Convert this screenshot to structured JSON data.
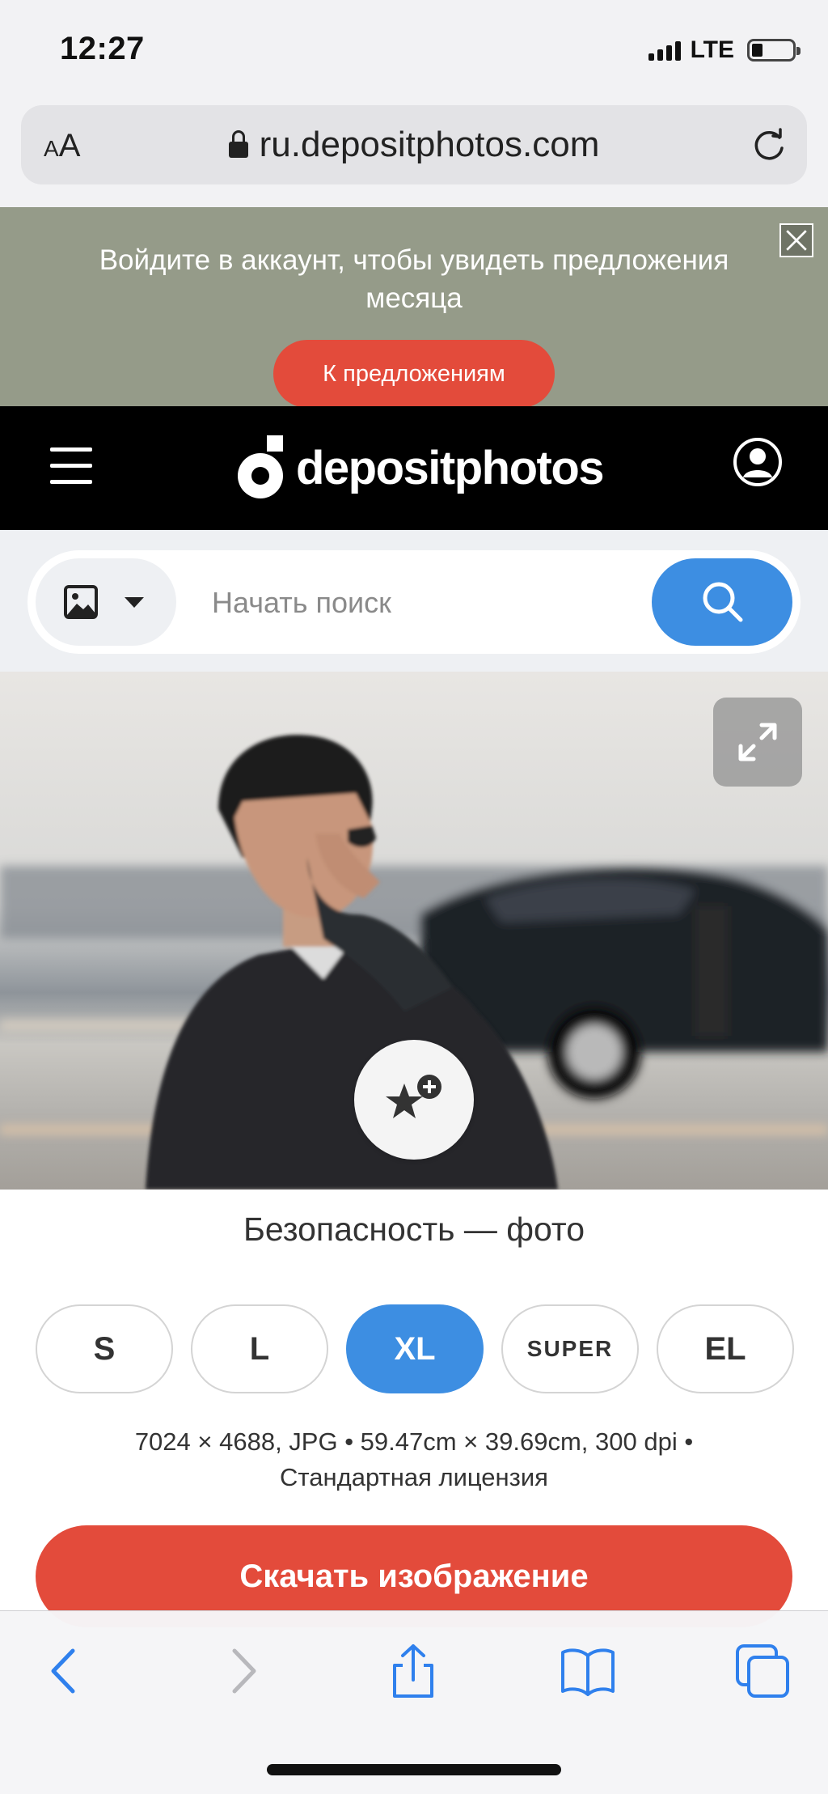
{
  "status_bar": {
    "time": "12:27",
    "network": "LTE"
  },
  "browser": {
    "text_size_label": "AA",
    "url": "ru.depositphotos.com"
  },
  "promo": {
    "text": "Войдите в аккаунт, чтобы увидеть предложения месяца",
    "button": "К предложениям"
  },
  "header": {
    "logo_text": "depositphotos"
  },
  "search": {
    "placeholder": "Начать поиск"
  },
  "photo": {
    "title": "Безопасность — фото"
  },
  "sizes": [
    {
      "label": "S",
      "selected": false
    },
    {
      "label": "L",
      "selected": false
    },
    {
      "label": "XL",
      "selected": true
    },
    {
      "label": "SUPER",
      "selected": false
    },
    {
      "label": "EL",
      "selected": false
    }
  ],
  "meta": {
    "line1": "7024 × 4688, JPG • 59.47cm × 39.69cm, 300 dpi •",
    "line2": "Стандартная лицензия"
  },
  "download_button": "Скачать изображение",
  "colors": {
    "accent_blue": "#3d8ee2",
    "accent_red": "#e34b3b",
    "promo_bg": "#959b89"
  },
  "icons": [
    "search-icon",
    "image-icon",
    "chevron-down-icon",
    "expand-icon",
    "favorite-add-icon",
    "back-icon",
    "forward-icon",
    "share-icon",
    "bookmarks-icon",
    "tabs-icon"
  ]
}
